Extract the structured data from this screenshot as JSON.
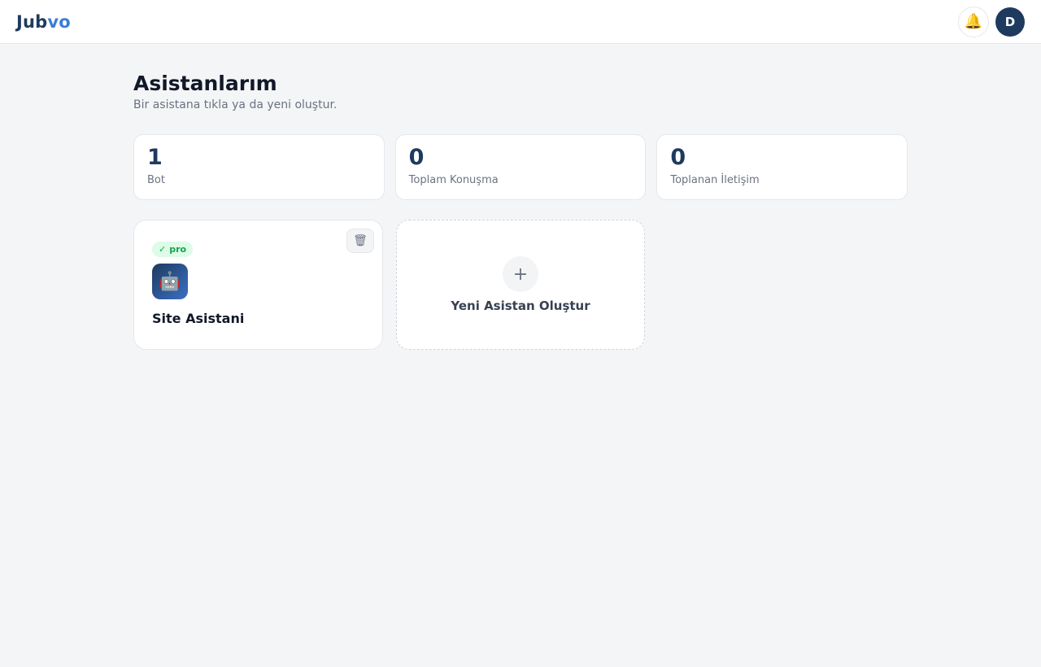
{
  "header": {
    "logo_part1": "Jub",
    "logo_part2": "vo",
    "bell_icon": "🔔",
    "avatar_initial": "D"
  },
  "page": {
    "title": "Asistanlarım",
    "subtitle": "Bir asistana tıkla ya da yeni oluştur."
  },
  "stats": [
    {
      "value": "1",
      "label": "Bot"
    },
    {
      "value": "0",
      "label": "Toplam Konuşma"
    },
    {
      "value": "0",
      "label": "Toplanan İletişim"
    }
  ],
  "bots": [
    {
      "badge_check": "✓",
      "badge_label": "pro",
      "avatar_glyph": "🤖",
      "name": "Site Asistani",
      "delete_glyph": "🗑"
    }
  ],
  "new_bot": {
    "plus_glyph": "+",
    "label": "Yeni Asistan Oluştur"
  },
  "colors": {
    "brand_dark": "#1e3a5f",
    "brand_light": "#3b7dd8",
    "badge_bg": "#dcfce7",
    "badge_text": "#16a34a"
  }
}
